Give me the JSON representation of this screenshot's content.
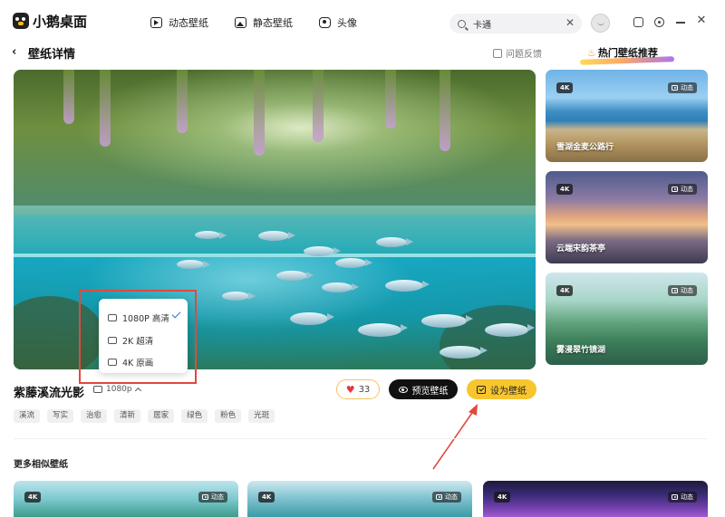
{
  "app": {
    "name": "小鹅桌面"
  },
  "nav": {
    "tabs": [
      {
        "label": "动态壁纸",
        "icon": "play-icon"
      },
      {
        "label": "静态壁纸",
        "icon": "image-icon"
      },
      {
        "label": "头像",
        "icon": "avatar-icon"
      }
    ]
  },
  "search": {
    "value": "卡通"
  },
  "header": {
    "back_icon": "‹",
    "title": "壁纸详情",
    "feedback": "问题反馈",
    "hot_title": "热门壁纸推荐"
  },
  "popup": {
    "items": [
      {
        "label": "1080P 高清",
        "selected": true
      },
      {
        "label": "2K 超清",
        "selected": false
      },
      {
        "label": "4K 原画",
        "selected": false
      }
    ]
  },
  "wallpaper": {
    "title": "紫藤溪流光影",
    "resolution": "1080p",
    "likes": "33",
    "tags": [
      "溪流",
      "写实",
      "治愈",
      "清新",
      "居家",
      "绿色",
      "粉色",
      "光斑"
    ]
  },
  "buttons": {
    "preview": "预览壁纸",
    "set": "设为壁纸"
  },
  "hot_cards": [
    {
      "badge": "4K",
      "type": "动态",
      "title": "雪湖金麦公路行"
    },
    {
      "badge": "4K",
      "type": "动态",
      "title": "云端宋韵茶亭"
    },
    {
      "badge": "4K",
      "type": "动态",
      "title": "雾漫翠竹镜湖"
    }
  ],
  "more": {
    "title": "更多相似壁纸",
    "cards": [
      {
        "badge": "4K",
        "type": "动态"
      },
      {
        "badge": "4K",
        "type": "动态"
      },
      {
        "badge": "4K",
        "type": "动态"
      }
    ]
  },
  "colors": {
    "accent_yellow": "#f7c62f",
    "annotation_red": "#e2493c",
    "check_blue": "#2b6fd6"
  }
}
